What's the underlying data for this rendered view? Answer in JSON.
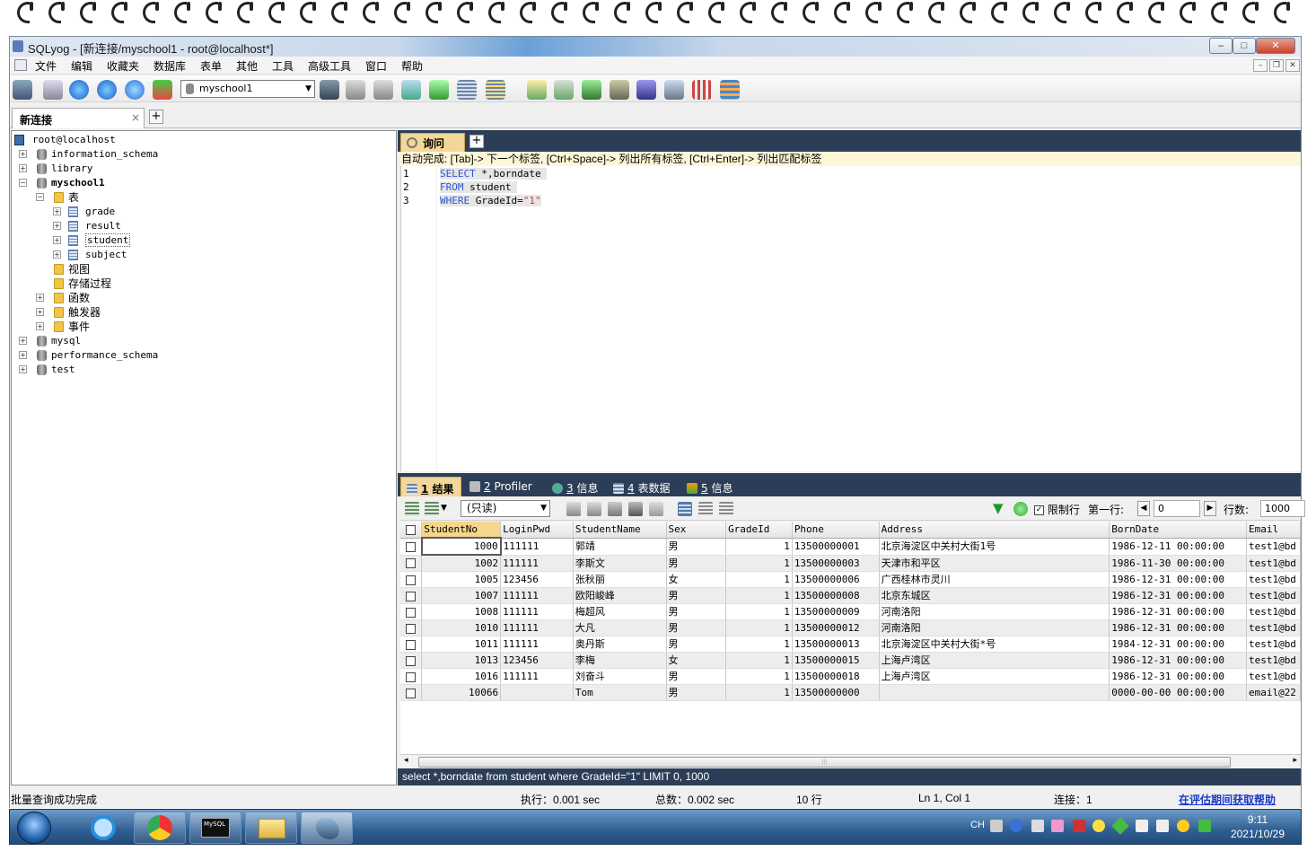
{
  "window": {
    "title": "SQLyog - [新连接/myschool1 - root@localhost*]"
  },
  "menu": [
    "文件",
    "编辑",
    "收藏夹",
    "数据库",
    "表单",
    "其他",
    "工具",
    "高级工具",
    "窗口",
    "帮助"
  ],
  "toolbar": {
    "db_select": "myschool1"
  },
  "connection_tab": {
    "label": "新连接",
    "close": "×",
    "add": "+"
  },
  "tree": {
    "root": "root@localhost",
    "databases": [
      "information_schema",
      "library",
      "myschool1",
      "mysql",
      "performance_schema",
      "test"
    ],
    "myschool1": {
      "tables_folder": "表",
      "tables": [
        "grade",
        "result",
        "student",
        "subject"
      ],
      "views": "视图",
      "procedures": "存储过程",
      "functions": "函数",
      "triggers": "触发器",
      "events": "事件"
    }
  },
  "query": {
    "tab_label": "询问",
    "add": "+",
    "autocomplete": "自动完成: [Tab]-> 下一个标签, [Ctrl+Space]-> 列出所有标签, [Ctrl+Enter]-> 列出匹配标签",
    "line_numbers": [
      "1",
      "2",
      "3"
    ],
    "lines": [
      {
        "kw": "SELECT",
        "rest": " *,borndate "
      },
      {
        "kw": "FROM",
        "rest": " student "
      },
      {
        "kw": "WHERE",
        "rest": " GradeId=",
        "str": "\"1\""
      }
    ]
  },
  "result_tabs": [
    {
      "num": "1",
      "label": "结果"
    },
    {
      "num": "2",
      "label": "Profiler"
    },
    {
      "num": "3",
      "label": "信息"
    },
    {
      "num": "4",
      "label": "表数据"
    },
    {
      "num": "5",
      "label": "信息"
    }
  ],
  "result_toolbar": {
    "mode": "(只读)",
    "limit_label": "限制行",
    "first_row_label": "第一行:",
    "first_row": "0",
    "rows_label": "行数:",
    "rows": "1000"
  },
  "grid": {
    "columns": [
      "StudentNo",
      "LoginPwd",
      "StudentName",
      "Sex",
      "GradeId",
      "Phone",
      "Address",
      "BornDate",
      "Email"
    ],
    "rows": [
      [
        "1000",
        "111111",
        "郭靖",
        "男",
        "1",
        "13500000001",
        "北京海淀区中关村大街1号",
        "1986-12-11 00:00:00",
        "test1@bd"
      ],
      [
        "1002",
        "111111",
        "李斯文",
        "男",
        "1",
        "13500000003",
        "天津市和平区",
        "1986-11-30 00:00:00",
        "test1@bd"
      ],
      [
        "1005",
        "123456",
        "张秋丽",
        "女",
        "1",
        "13500000006",
        "广西桂林市灵川",
        "1986-12-31 00:00:00",
        "test1@bd"
      ],
      [
        "1007",
        "111111",
        "欧阳峻峰",
        "男",
        "1",
        "13500000008",
        "北京东城区",
        "1986-12-31 00:00:00",
        "test1@bd"
      ],
      [
        "1008",
        "111111",
        "梅超风",
        "男",
        "1",
        "13500000009",
        "河南洛阳",
        "1986-12-31 00:00:00",
        "test1@bd"
      ],
      [
        "1010",
        "111111",
        "大凡",
        "男",
        "1",
        "13500000012",
        "河南洛阳",
        "1986-12-31 00:00:00",
        "test1@bd"
      ],
      [
        "1011",
        "111111",
        "奥丹斯",
        "男",
        "1",
        "13500000013",
        "北京海淀区中关村大街*号",
        "1984-12-31 00:00:00",
        "test1@bd"
      ],
      [
        "1013",
        "123456",
        "李梅",
        "女",
        "1",
        "13500000015",
        "上海卢湾区",
        "1986-12-31 00:00:00",
        "test1@bd"
      ],
      [
        "1016",
        "111111",
        "刘奋斗",
        "男",
        "1",
        "13500000018",
        "上海卢湾区",
        "1986-12-31 00:00:00",
        "test1@bd"
      ],
      [
        "10066",
        "",
        "Tom",
        "男",
        "1",
        "13500000000",
        "",
        "0000-00-00 00:00:00",
        "email@22"
      ]
    ]
  },
  "sql_status": "select *,borndate from student where GradeId=\"1\" LIMIT 0, 1000",
  "status": {
    "message": "批量查询成功完成",
    "exec": "执行：0.001 sec",
    "total": "总数：0.002 sec",
    "rows": "10 行",
    "position": "Ln 1, Col 1",
    "connections": "连接：1",
    "help": "在评估期间获取帮助"
  },
  "taskbar": {
    "ime": "CH",
    "time": "9:11",
    "date": "2021/10/29",
    "mysql_app": "MySQL"
  }
}
